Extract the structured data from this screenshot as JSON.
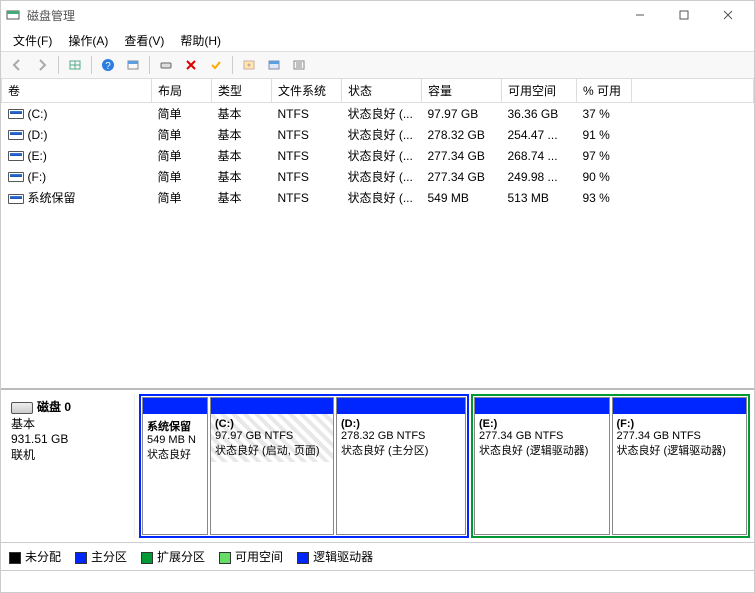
{
  "window": {
    "title": "磁盘管理"
  },
  "menu": {
    "file": "文件(F)",
    "action": "操作(A)",
    "view": "查看(V)",
    "help": "帮助(H)"
  },
  "columns": {
    "volume": "卷",
    "layout": "布局",
    "type": "类型",
    "fs": "文件系统",
    "status": "状态",
    "capacity": "容量",
    "free": "可用空间",
    "pct": "% 可用"
  },
  "volumes": [
    {
      "name": "(C:)",
      "layout": "简单",
      "type": "基本",
      "fs": "NTFS",
      "status": "状态良好 (...",
      "cap": "97.97 GB",
      "free": "36.36 GB",
      "pct": "37 %"
    },
    {
      "name": "(D:)",
      "layout": "简单",
      "type": "基本",
      "fs": "NTFS",
      "status": "状态良好 (...",
      "cap": "278.32 GB",
      "free": "254.47 ...",
      "pct": "91 %"
    },
    {
      "name": "(E:)",
      "layout": "简单",
      "type": "基本",
      "fs": "NTFS",
      "status": "状态良好 (...",
      "cap": "277.34 GB",
      "free": "268.74 ...",
      "pct": "97 %"
    },
    {
      "name": "(F:)",
      "layout": "简单",
      "type": "基本",
      "fs": "NTFS",
      "status": "状态良好 (...",
      "cap": "277.34 GB",
      "free": "249.98 ...",
      "pct": "90 %"
    },
    {
      "name": "系统保留",
      "layout": "简单",
      "type": "基本",
      "fs": "NTFS",
      "status": "状态良好 (...",
      "cap": "549 MB",
      "free": "513 MB",
      "pct": "93 %"
    }
  ],
  "disk": {
    "label": "磁盘 0",
    "type": "基本",
    "size": "931.51 GB",
    "status": "联机",
    "partitions": {
      "sysres": {
        "title": "系统保留",
        "line2": "549 MB N",
        "line3": "状态良好"
      },
      "c": {
        "title": "(C:)",
        "line2": "97.97 GB NTFS",
        "line3": "状态良好 (启动, 页面)"
      },
      "d": {
        "title": "(D:)",
        "line2": "278.32 GB NTFS",
        "line3": "状态良好 (主分区)"
      },
      "e": {
        "title": "(E:)",
        "line2": "277.34 GB NTFS",
        "line3": "状态良好 (逻辑驱动器)"
      },
      "f": {
        "title": "(F:)",
        "line2": "277.34 GB NTFS",
        "line3": "状态良好 (逻辑驱动器)"
      }
    }
  },
  "legend": {
    "unalloc": "未分配",
    "primary": "主分区",
    "extended": "扩展分区",
    "free": "可用空间",
    "logical": "逻辑驱动器"
  }
}
